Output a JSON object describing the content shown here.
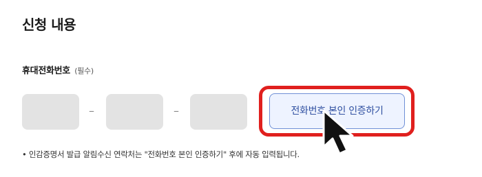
{
  "section": {
    "title": "신청 내용"
  },
  "phone_field": {
    "label": "휴대전화번호",
    "required_tag": "(필수)",
    "separator": "–",
    "parts": [
      {
        "value": ""
      },
      {
        "value": ""
      },
      {
        "value": ""
      }
    ]
  },
  "verify_button": {
    "label": "전화번호 본인 인증하기",
    "highlight_color": "#e0201e"
  },
  "note": {
    "text": "• 인감증명서 발급 알림수신 연락처는 \"전화번호 본인 인증하기\" 후에 자동 입력됩니다."
  },
  "cursor": {
    "icon": "mouse-pointer-icon"
  }
}
